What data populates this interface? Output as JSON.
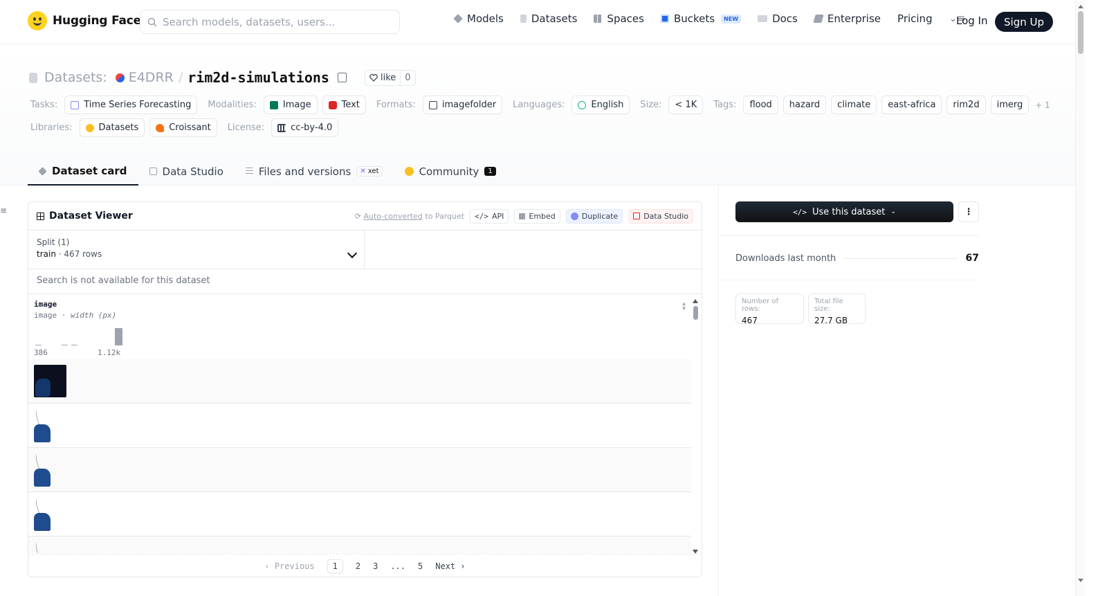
{
  "nav": {
    "brand": "Hugging Face",
    "search_placeholder": "Search models, datasets, users...",
    "links": [
      {
        "label": "Models",
        "icon": "models-icon",
        "color": "#9ca3af"
      },
      {
        "label": "Datasets",
        "icon": "datasets-icon",
        "color": "#9ca3af"
      },
      {
        "label": "Spaces",
        "icon": "spaces-icon",
        "color": "#9ca3af"
      },
      {
        "label": "Buckets",
        "icon": "buckets-icon",
        "color": "#2563eb"
      },
      {
        "label": "Docs",
        "icon": "docs-icon",
        "color": "#9ca3af"
      },
      {
        "label": "Enterprise",
        "icon": "enterprise-icon",
        "color": "#6b7280"
      },
      {
        "label": "Pricing"
      }
    ],
    "new_badge": "NEW",
    "login": "Log In",
    "signup": "Sign Up"
  },
  "dataset": {
    "prefix": "Datasets:",
    "owner": "E4DRR",
    "name": "rim2d-simulations",
    "like_label": "like",
    "like_count": "0"
  },
  "meta": {
    "tasks_label": "Tasks:",
    "tasks": [
      "Time Series Forecasting"
    ],
    "modalities_label": "Modalities:",
    "modalities": [
      "Image",
      "Text"
    ],
    "formats_label": "Formats:",
    "formats": [
      "imagefolder"
    ],
    "languages_label": "Languages:",
    "languages": [
      "English"
    ],
    "size_label": "Size:",
    "size": "< 1K",
    "tags_label": "Tags:",
    "tags": [
      "flood",
      "hazard",
      "climate",
      "east-africa",
      "rim2d",
      "imerg"
    ],
    "tags_more": "+ 1",
    "libraries_label": "Libraries:",
    "libraries": [
      "Datasets",
      "Croissant"
    ],
    "license_label": "License:",
    "license": "cc-by-4.0"
  },
  "tabs": [
    {
      "label": "Dataset card",
      "active": true
    },
    {
      "label": "Data Studio"
    },
    {
      "label": "Files and versions",
      "badge": "xet"
    },
    {
      "label": "Community",
      "count": "1"
    }
  ],
  "viewer": {
    "title": "Dataset Viewer",
    "auto_converted": "Auto-converted",
    "to_parquet": "to Parquet",
    "api": "API",
    "embed": "Embed",
    "duplicate": "Duplicate",
    "data_studio": "Data Studio",
    "split_label": "Split (1)",
    "split_name": "train",
    "split_rows": "467 rows",
    "search_disabled": "Search is not available for this dataset",
    "column": {
      "name": "image",
      "type": "image",
      "stat": "width (px)",
      "hist_min": "386",
      "hist_max": "1.12k"
    },
    "pagination": {
      "previous": "Previous",
      "pages": [
        "1",
        "2",
        "3",
        "...",
        "5"
      ],
      "next": "Next"
    }
  },
  "sidebar": {
    "use_dataset": "Use this dataset",
    "downloads_label": "Downloads last month",
    "downloads": "67",
    "rows_label": "Number of rows:",
    "rows": "467",
    "size_label": "Total file size:",
    "size": "27.7 GB"
  }
}
